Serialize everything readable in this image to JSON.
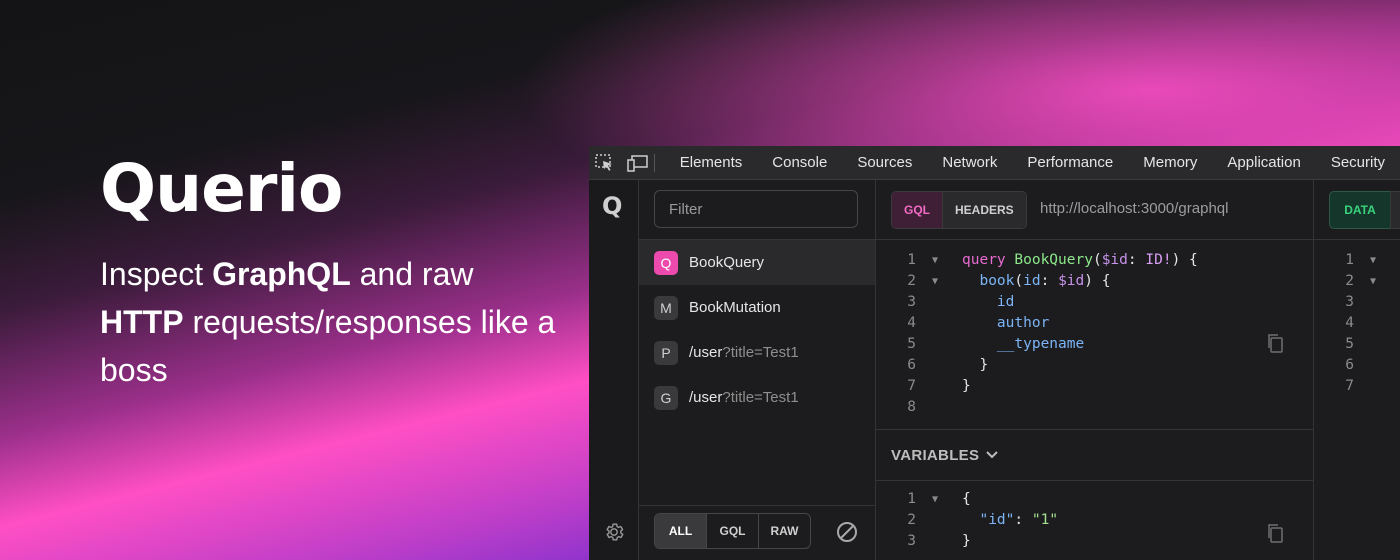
{
  "hero": {
    "brand": "Querio",
    "tag_1": "Inspect ",
    "tag_bold_1": "GraphQL",
    "tag_2": " and raw ",
    "tag_bold_2": "HTTP",
    "tag_3": " requests/responses like a boss"
  },
  "devtools_tabs": [
    "Elements",
    "Console",
    "Sources",
    "Network",
    "Performance",
    "Memory",
    "Application",
    "Security"
  ],
  "sidebar": {
    "logo": "Q"
  },
  "filter": {
    "placeholder": "Filter"
  },
  "requests": [
    {
      "badge": "Q",
      "name": "BookQuery",
      "query": ""
    },
    {
      "badge": "M",
      "name": "BookMutation",
      "query": ""
    },
    {
      "badge": "P",
      "name": "/user",
      "query": "?title=Test1"
    },
    {
      "badge": "G",
      "name": "/user",
      "query": "?title=Test1"
    }
  ],
  "filter_buttons": [
    "ALL",
    "GQL",
    "RAW"
  ],
  "editor": {
    "tabs": [
      "GQL",
      "HEADERS"
    ],
    "url": "http://localhost:3000/graphql",
    "line_numbers": [
      "1",
      "2",
      "3",
      "4",
      "5",
      "6",
      "7",
      "8"
    ],
    "variables_label": "VARIABLES",
    "variables_line_numbers": [
      "1",
      "2",
      "3"
    ]
  },
  "response": {
    "tab": "DATA",
    "line_numbers": [
      "1",
      "2",
      "3",
      "4",
      "5",
      "6",
      "7"
    ]
  },
  "colors": {
    "accent_pink": "#ec4aad",
    "data_green": "#39d37c"
  }
}
